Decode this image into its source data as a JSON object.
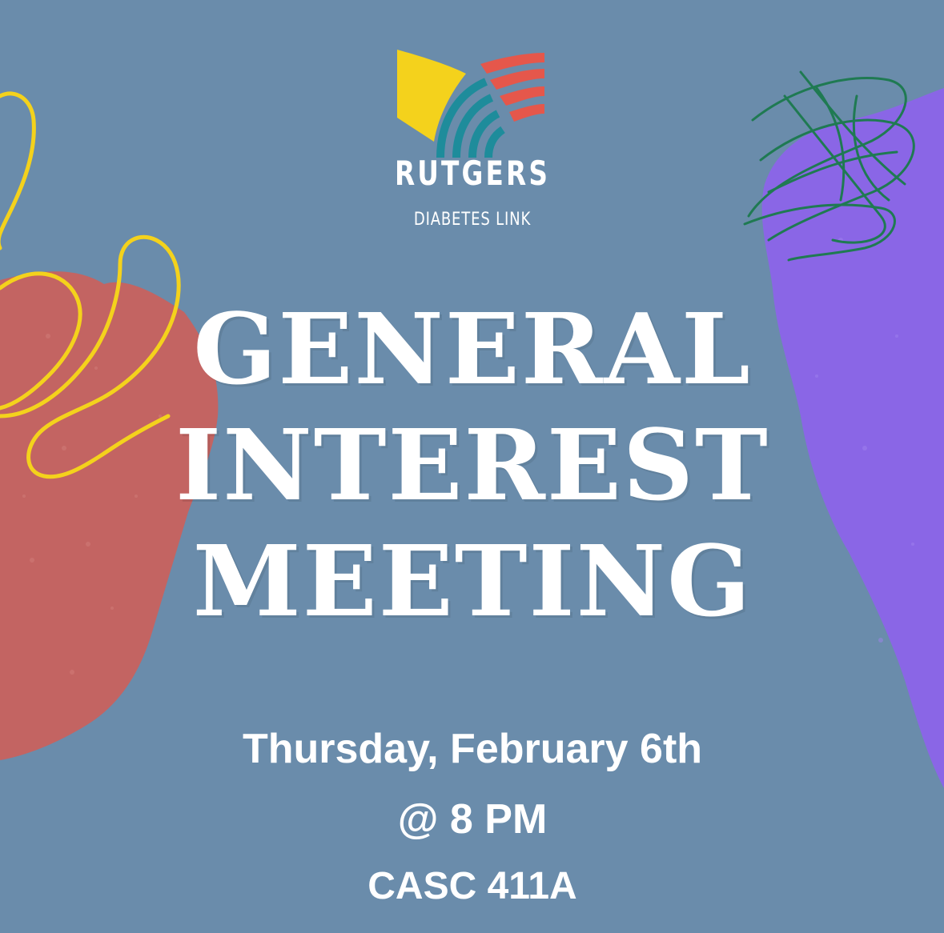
{
  "logo": {
    "name": "RUTGERS",
    "subtitle": "DIABETES LINK"
  },
  "headline": {
    "line1": "GENERAL",
    "line2": "INTEREST",
    "line3": "MEETING"
  },
  "details": {
    "date": "Thursday, February 6th",
    "time": "@ 8 PM",
    "location": "CASC 411A"
  },
  "colors": {
    "background": "#6a8cab",
    "coral": "#c8625e",
    "purple": "#8a66e6",
    "yellow": "#f4d21c",
    "teal": "#1e8c9b",
    "red": "#e5574b",
    "green": "#1f7a52"
  }
}
